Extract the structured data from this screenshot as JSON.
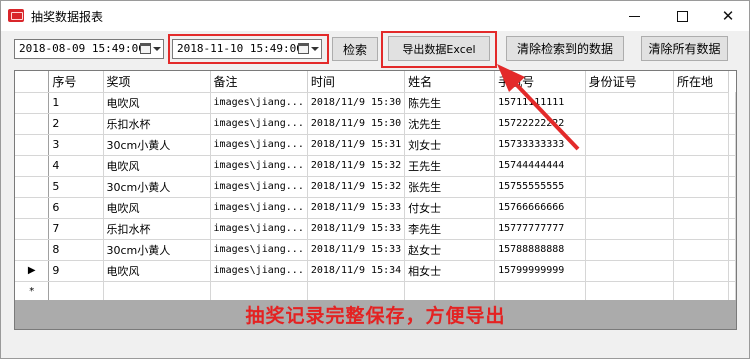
{
  "window": {
    "title": "抽奖数据报表"
  },
  "toolbar": {
    "start_date": "2018-08-09 15:49:00",
    "end_date": "2018-11-10 15:49:00",
    "search_label": "检索",
    "export_label": "导出数据Excel",
    "clear_found_label": "清除检索到的数据",
    "clear_all_label": "清除所有数据"
  },
  "grid": {
    "columns": [
      "序号",
      "奖项",
      "备注",
      "时间",
      "姓名",
      "手机号",
      "身份证号",
      "所在地"
    ],
    "rows": [
      {
        "no": "1",
        "prize": "电吹风",
        "note": "images\\jiang...",
        "time": "2018/11/9 15:30",
        "name": "陈先生",
        "phone": "15711111111",
        "id": "",
        "loc": ""
      },
      {
        "no": "2",
        "prize": "乐扣水杯",
        "note": "images\\jiang...",
        "time": "2018/11/9 15:30",
        "name": "沈先生",
        "phone": "15722222222",
        "id": "",
        "loc": ""
      },
      {
        "no": "3",
        "prize": "30cm小黄人",
        "note": "images\\jiang...",
        "time": "2018/11/9 15:31",
        "name": "刘女士",
        "phone": "15733333333",
        "id": "",
        "loc": ""
      },
      {
        "no": "4",
        "prize": "电吹风",
        "note": "images\\jiang...",
        "time": "2018/11/9 15:32",
        "name": "王先生",
        "phone": "15744444444",
        "id": "",
        "loc": ""
      },
      {
        "no": "5",
        "prize": "30cm小黄人",
        "note": "images\\jiang...",
        "time": "2018/11/9 15:32",
        "name": "张先生",
        "phone": "15755555555",
        "id": "",
        "loc": ""
      },
      {
        "no": "6",
        "prize": "电吹风",
        "note": "images\\jiang...",
        "time": "2018/11/9 15:33",
        "name": "付女士",
        "phone": "15766666666",
        "id": "",
        "loc": ""
      },
      {
        "no": "7",
        "prize": "乐扣水杯",
        "note": "images\\jiang...",
        "time": "2018/11/9 15:33",
        "name": "李先生",
        "phone": "15777777777",
        "id": "",
        "loc": ""
      },
      {
        "no": "8",
        "prize": "30cm小黄人",
        "note": "images\\jiang...",
        "time": "2018/11/9 15:33",
        "name": "赵女士",
        "phone": "15788888888",
        "id": "",
        "loc": ""
      },
      {
        "no": "9",
        "prize": "电吹风",
        "note": "images\\jiang...",
        "time": "2018/11/9 15:34",
        "name": "相女士",
        "phone": "15799999999",
        "id": "",
        "loc": ""
      }
    ],
    "current_row_marker": "▶",
    "new_row_marker": "*"
  },
  "promo_text": "抽奖记录完整保存，方便导出",
  "colors": {
    "highlight": "#e32a2a",
    "promo": "#e42222",
    "footer_band": "#ababab"
  }
}
